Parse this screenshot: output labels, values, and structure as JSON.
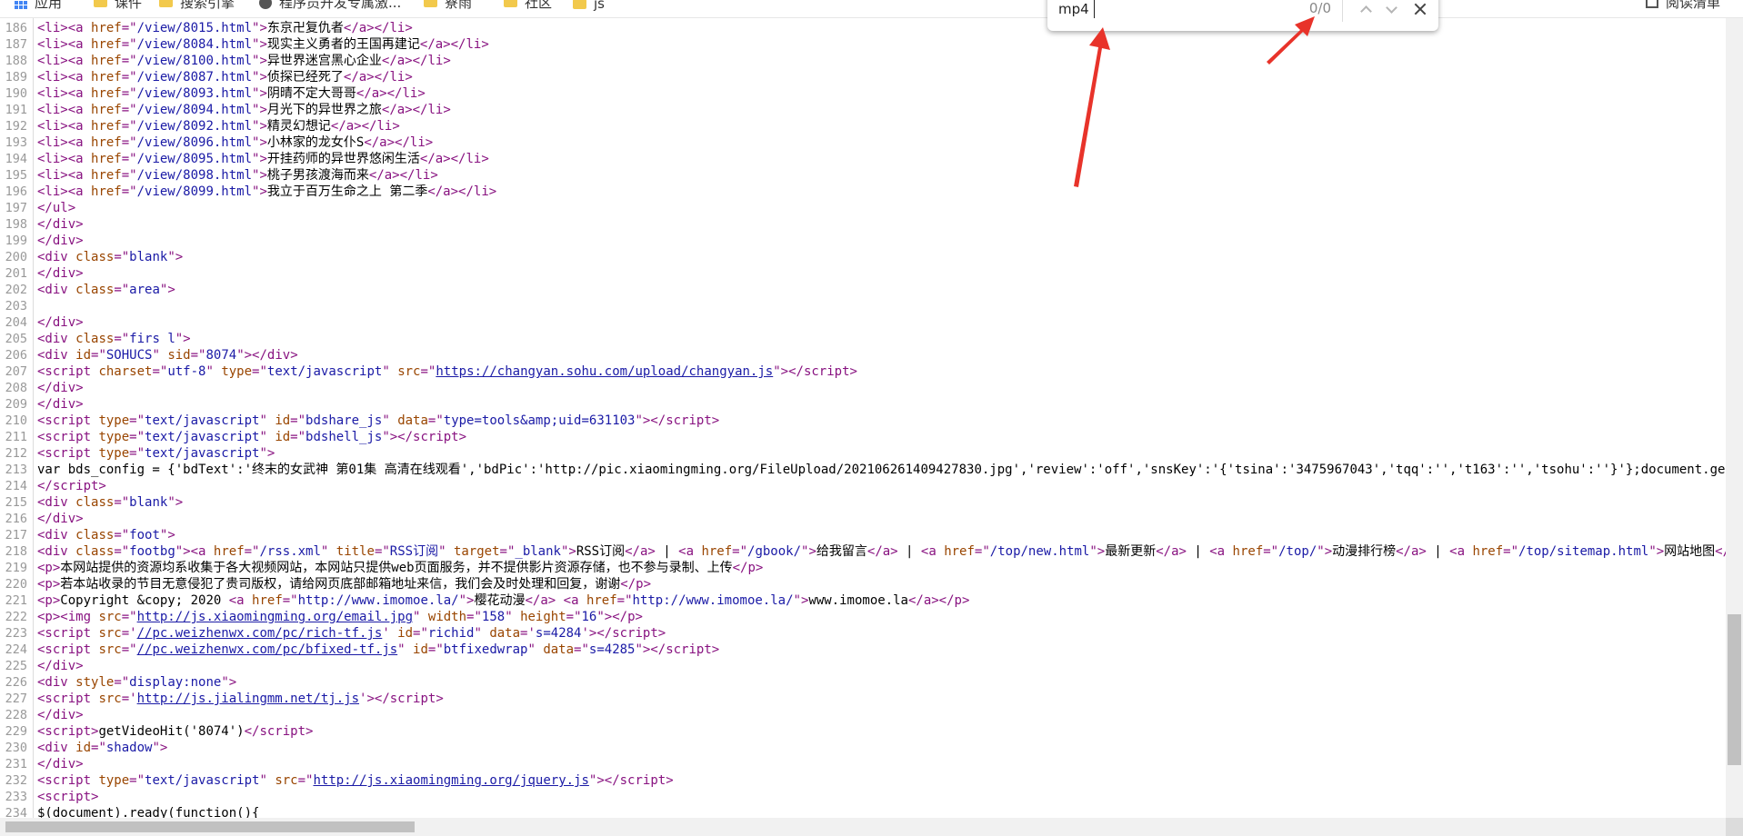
{
  "bookmarks": [
    {
      "label": "应用",
      "icon": "apps-grid-icon"
    },
    {
      "label": "课件",
      "icon": "folder-icon"
    },
    {
      "label": "搜索引擎",
      "icon": "folder-icon"
    },
    {
      "label": "程序员开发专属激...",
      "icon": "globe-icon"
    },
    {
      "label": "寮雨",
      "icon": "folder-icon"
    },
    {
      "label": "社区",
      "icon": "folder-icon"
    },
    {
      "label": "js",
      "icon": "folder-icon"
    },
    {
      "label": "阅读清单",
      "icon": "reading-list-icon"
    }
  ],
  "find": {
    "query": "mp4",
    "count": "0/0"
  },
  "colors": {
    "tag": "#881280",
    "attribute": "#994500",
    "value": "#1a1aa6",
    "annotation_arrow": "#e8332a"
  },
  "code_lines": [
    {
      "n": "186",
      "html": "<span class='tag'>&lt;li&gt;&lt;a </span><span class='attr'>href</span><span class='tag'>=\"</span><span class='val'>/view/8015.html</span><span class='tag'>\"&gt;</span>东京卍复仇者<span class='tag'>&lt;/a&gt;&lt;/li&gt;</span>"
    },
    {
      "n": "187",
      "html": "<span class='tag'>&lt;li&gt;&lt;a </span><span class='attr'>href</span><span class='tag'>=\"</span><span class='val'>/view/8084.html</span><span class='tag'>\"&gt;</span>现实主义勇者的王国再建记<span class='tag'>&lt;/a&gt;&lt;/li&gt;</span>"
    },
    {
      "n": "188",
      "html": "<span class='tag'>&lt;li&gt;&lt;a </span><span class='attr'>href</span><span class='tag'>=\"</span><span class='val'>/view/8100.html</span><span class='tag'>\"&gt;</span>异世界迷宫黑心企业<span class='tag'>&lt;/a&gt;&lt;/li&gt;</span>"
    },
    {
      "n": "189",
      "html": "<span class='tag'>&lt;li&gt;&lt;a </span><span class='attr'>href</span><span class='tag'>=\"</span><span class='val'>/view/8087.html</span><span class='tag'>\"&gt;</span>侦探已经死了<span class='tag'>&lt;/a&gt;&lt;/li&gt;</span>"
    },
    {
      "n": "190",
      "html": "<span class='tag'>&lt;li&gt;&lt;a </span><span class='attr'>href</span><span class='tag'>=\"</span><span class='val'>/view/8093.html</span><span class='tag'>\"&gt;</span>阴晴不定大哥哥<span class='tag'>&lt;/a&gt;&lt;/li&gt;</span>"
    },
    {
      "n": "191",
      "html": "<span class='tag'>&lt;li&gt;&lt;a </span><span class='attr'>href</span><span class='tag'>=\"</span><span class='val'>/view/8094.html</span><span class='tag'>\"&gt;</span>月光下的异世界之旅<span class='tag'>&lt;/a&gt;&lt;/li&gt;</span>"
    },
    {
      "n": "192",
      "html": "<span class='tag'>&lt;li&gt;&lt;a </span><span class='attr'>href</span><span class='tag'>=\"</span><span class='val'>/view/8092.html</span><span class='tag'>\"&gt;</span>精灵幻想记<span class='tag'>&lt;/a&gt;&lt;/li&gt;</span>"
    },
    {
      "n": "193",
      "html": "<span class='tag'>&lt;li&gt;&lt;a </span><span class='attr'>href</span><span class='tag'>=\"</span><span class='val'>/view/8096.html</span><span class='tag'>\"&gt;</span>小林家的龙女仆S<span class='tag'>&lt;/a&gt;&lt;/li&gt;</span>"
    },
    {
      "n": "194",
      "html": "<span class='tag'>&lt;li&gt;&lt;a </span><span class='attr'>href</span><span class='tag'>=\"</span><span class='val'>/view/8095.html</span><span class='tag'>\"&gt;</span>开挂药师的异世界悠闲生活<span class='tag'>&lt;/a&gt;&lt;/li&gt;</span>"
    },
    {
      "n": "195",
      "html": "<span class='tag'>&lt;li&gt;&lt;a </span><span class='attr'>href</span><span class='tag'>=\"</span><span class='val'>/view/8098.html</span><span class='tag'>\"&gt;</span>桃子男孩渡海而来<span class='tag'>&lt;/a&gt;&lt;/li&gt;</span>"
    },
    {
      "n": "196",
      "html": "<span class='tag'>&lt;li&gt;&lt;a </span><span class='attr'>href</span><span class='tag'>=\"</span><span class='val'>/view/8099.html</span><span class='tag'>\"&gt;</span>我立于百万生命之上 第二季<span class='tag'>&lt;/a&gt;&lt;/li&gt;</span>"
    },
    {
      "n": "197",
      "html": "<span class='tag'>&lt;/ul&gt;</span>"
    },
    {
      "n": "198",
      "html": "<span class='tag'>&lt;/div&gt;</span>"
    },
    {
      "n": "199",
      "html": "<span class='tag'>&lt;/div&gt;</span>"
    },
    {
      "n": "200",
      "html": "<span class='tag'>&lt;div </span><span class='attr'>class</span><span class='tag'>=\"</span><span class='val'>blank</span><span class='tag'>\"&gt;</span>"
    },
    {
      "n": "201",
      "html": "<span class='tag'>&lt;/div&gt;</span>"
    },
    {
      "n": "202",
      "html": "<span class='tag'>&lt;div </span><span class='attr'>class</span><span class='tag'>=\"</span><span class='val'>area</span><span class='tag'>\"&gt;</span>"
    },
    {
      "n": "203",
      "html": ""
    },
    {
      "n": "204",
      "html": "<span class='tag'>&lt;/div&gt;</span>"
    },
    {
      "n": "205",
      "html": "<span class='tag'>&lt;div </span><span class='attr'>class</span><span class='tag'>=\"</span><span class='val'>firs l</span><span class='tag'>\"&gt;</span>"
    },
    {
      "n": "206",
      "html": "<span class='tag'>&lt;div </span><span class='attr'>id</span><span class='tag'>=\"</span><span class='val'>SOHUCS</span><span class='tag'>\" </span><span class='attr'>sid</span><span class='tag'>=\"</span><span class='val'>8074</span><span class='tag'>\"&gt;&lt;/div&gt;</span>"
    },
    {
      "n": "207",
      "html": "<span class='tag'>&lt;script </span><span class='attr'>charset</span><span class='tag'>=\"</span><span class='val'>utf-8</span><span class='tag'>\" </span><span class='attr'>type</span><span class='tag'>=\"</span><span class='val'>text/javascript</span><span class='tag'>\" </span><span class='attr'>src</span><span class='tag'>=\"</span><span class='lnk'>https://changyan.sohu.com/upload/changyan.js</span><span class='tag'>\"&gt;&lt;/script&gt;</span>"
    },
    {
      "n": "208",
      "html": "<span class='tag'>&lt;/div&gt;</span>"
    },
    {
      "n": "209",
      "html": "<span class='tag'>&lt;/div&gt;</span>"
    },
    {
      "n": "210",
      "html": "<span class='tag'>&lt;script </span><span class='attr'>type</span><span class='tag'>=\"</span><span class='val'>text/javascript</span><span class='tag'>\" </span><span class='attr'>id</span><span class='tag'>=\"</span><span class='val'>bdshare_js</span><span class='tag'>\" </span><span class='attr'>data</span><span class='tag'>=\"</span><span class='val'>type=tools&amp;amp;uid=631103</span><span class='tag'>\"&gt;&lt;/script&gt;</span>"
    },
    {
      "n": "211",
      "html": "<span class='tag'>&lt;script </span><span class='attr'>type</span><span class='tag'>=\"</span><span class='val'>text/javascript</span><span class='tag'>\" </span><span class='attr'>id</span><span class='tag'>=\"</span><span class='val'>bdshell_js</span><span class='tag'>\"&gt;&lt;/script&gt;</span>"
    },
    {
      "n": "212",
      "html": "<span class='tag'>&lt;script </span><span class='attr'>type</span><span class='tag'>=\"</span><span class='val'>text/javascript</span><span class='tag'>\"&gt;</span>"
    },
    {
      "n": "213",
      "html": "var bds_config = {'bdText':'终末的女武神 第01集 高清在线观看','bdPic':'http://pic.xiaomingming.org/FileUpload/202106261409427830.jpg','review':'off','snsKey':'{'tsina':'3475967043','tqq':'','t163':'','tsohu':''}'};document.getElemen"
    },
    {
      "n": "214",
      "html": "<span class='tag'>&lt;/script&gt;</span>"
    },
    {
      "n": "215",
      "html": "<span class='tag'>&lt;div </span><span class='attr'>class</span><span class='tag'>=\"</span><span class='val'>blank</span><span class='tag'>\"&gt;</span>"
    },
    {
      "n": "216",
      "html": "<span class='tag'>&lt;/div&gt;</span>"
    },
    {
      "n": "217",
      "html": "<span class='tag'>&lt;div </span><span class='attr'>class</span><span class='tag'>=\"</span><span class='val'>foot</span><span class='tag'>\"&gt;</span>"
    },
    {
      "n": "218",
      "html": "<span class='tag'>&lt;div </span><span class='attr'>class</span><span class='tag'>=\"</span><span class='val'>footbg</span><span class='tag'>\"&gt;&lt;a </span><span class='attr'>href</span><span class='tag'>=\"</span><span class='val'>/rss.xml</span><span class='tag'>\" </span><span class='attr'>title</span><span class='tag'>=\"</span><span class='val'>RSS订阅</span><span class='tag'>\" </span><span class='attr'>target</span><span class='tag'>=\"</span><span class='val'>_blank</span><span class='tag'>\"&gt;</span>RSS订阅<span class='tag'>&lt;/a&gt;</span> | <span class='tag'>&lt;a </span><span class='attr'>href</span><span class='tag'>=\"</span><span class='val'>/gbook/</span><span class='tag'>\"&gt;</span>给我留言<span class='tag'>&lt;/a&gt;</span> | <span class='tag'>&lt;a </span><span class='attr'>href</span><span class='tag'>=\"</span><span class='val'>/top/new.html</span><span class='tag'>\"&gt;</span>最新更新<span class='tag'>&lt;/a&gt;</span> | <span class='tag'>&lt;a </span><span class='attr'>href</span><span class='tag'>=\"</span><span class='val'>/top/</span><span class='tag'>\"&gt;</span>动漫排行榜<span class='tag'>&lt;/a&gt;</span> | <span class='tag'>&lt;a </span><span class='attr'>href</span><span class='tag'>=\"</span><span class='val'>/top/sitemap.html</span><span class='tag'>\"&gt;</span>网站地图<span class='tag'>&lt;/a&gt;</span> |"
    },
    {
      "n": "219",
      "html": "<span class='tag'>&lt;p&gt;</span>本网站提供的资源均系收集于各大视频网站，本网站只提供web页面服务，并不提供影片资源存储，也不参与录制、上传<span class='tag'>&lt;/p&gt;</span>"
    },
    {
      "n": "220",
      "html": "<span class='tag'>&lt;p&gt;</span>若本站收录的节目无意侵犯了贵司版权，请给网页底部邮箱地址来信，我们会及时处理和回复，谢谢<span class='tag'>&lt;/p&gt;</span>"
    },
    {
      "n": "221",
      "html": "<span class='tag'>&lt;p&gt;</span>Copyright &amp;copy; 2020 <span class='tag'>&lt;a </span><span class='attr'>href</span><span class='tag'>=\"</span><span class='val'>http://www.imomoe.la/</span><span class='tag'>\"&gt;</span>樱花动漫<span class='tag'>&lt;/a&gt;</span> <span class='tag'>&lt;a </span><span class='attr'>href</span><span class='tag'>=\"</span><span class='val'>http://www.imomoe.la/</span><span class='tag'>\"&gt;</span>www.imomoe.la<span class='tag'>&lt;/a&gt;&lt;/p&gt;</span>"
    },
    {
      "n": "222",
      "html": "<span class='tag'>&lt;p&gt;&lt;img </span><span class='attr'>src</span><span class='tag'>=\"</span><span class='lnk'>http://js.xiaomingming.org/email.jpg</span><span class='tag'>\" </span><span class='attr'>width</span><span class='tag'>=\"</span><span class='val'>158</span><span class='tag'>\" </span><span class='attr'>height</span><span class='tag'>=\"</span><span class='val'>16</span><span class='tag'>\"&gt;&lt;/p&gt;</span>"
    },
    {
      "n": "223",
      "html": "<span class='tag'>&lt;script </span><span class='attr'>src</span><span class='tag'>='</span><span class='lnk'>//pc.weizhenwx.com/pc/rich-tf.js</span><span class='tag'>' </span><span class='attr'>id</span><span class='tag'>=\"</span><span class='val'>richid</span><span class='tag'>\" </span><span class='attr'>data</span><span class='tag'>='</span><span class='val'>s=4284</span><span class='tag'>'&gt;&lt;/script&gt;</span>"
    },
    {
      "n": "224",
      "html": "<span class='tag'>&lt;script </span><span class='attr'>src</span><span class='tag'>=\"</span><span class='lnk'>//pc.weizhenwx.com/pc/bfixed-tf.js</span><span class='tag'>\" </span><span class='attr'>id</span><span class='tag'>=\"</span><span class='val'>btfixedwrap</span><span class='tag'>\" </span><span class='attr'>data</span><span class='tag'>=\"</span><span class='val'>s=4285</span><span class='tag'>\"&gt;&lt;/script&gt;</span>"
    },
    {
      "n": "225",
      "html": "<span class='tag'>&lt;/div&gt;</span>"
    },
    {
      "n": "226",
      "html": "<span class='tag'>&lt;div </span><span class='attr'>style</span><span class='tag'>=\"</span><span class='val'>display:none</span><span class='tag'>\"&gt;</span>"
    },
    {
      "n": "227",
      "html": "<span class='tag'>&lt;script </span><span class='attr'>src</span><span class='tag'>='</span><span class='lnk'>http://js.jialingmm.net/tj.js</span><span class='tag'>'&gt;&lt;/script&gt;</span>"
    },
    {
      "n": "228",
      "html": "<span class='tag'>&lt;/div&gt;</span>"
    },
    {
      "n": "229",
      "html": "<span class='tag'>&lt;script&gt;</span>getVideoHit('8074')<span class='tag'>&lt;/script&gt;</span>"
    },
    {
      "n": "230",
      "html": "<span class='tag'>&lt;div </span><span class='attr'>id</span><span class='tag'>=\"</span><span class='val'>shadow</span><span class='tag'>\"&gt;</span>"
    },
    {
      "n": "231",
      "html": "<span class='tag'>&lt;/div&gt;</span>"
    },
    {
      "n": "232",
      "html": "<span class='tag'>&lt;script </span><span class='attr'>type</span><span class='tag'>=\"</span><span class='val'>text/javascript</span><span class='tag'>\" </span><span class='attr'>src</span><span class='tag'>=\"</span><span class='lnk'>http://js.xiaomingming.org/jquery.js</span><span class='tag'>\"&gt;&lt;/script&gt;</span>"
    },
    {
      "n": "233",
      "html": "<span class='tag'>&lt;script&gt;</span>"
    },
    {
      "n": "234",
      "html": "$(document).ready(function(){"
    }
  ]
}
